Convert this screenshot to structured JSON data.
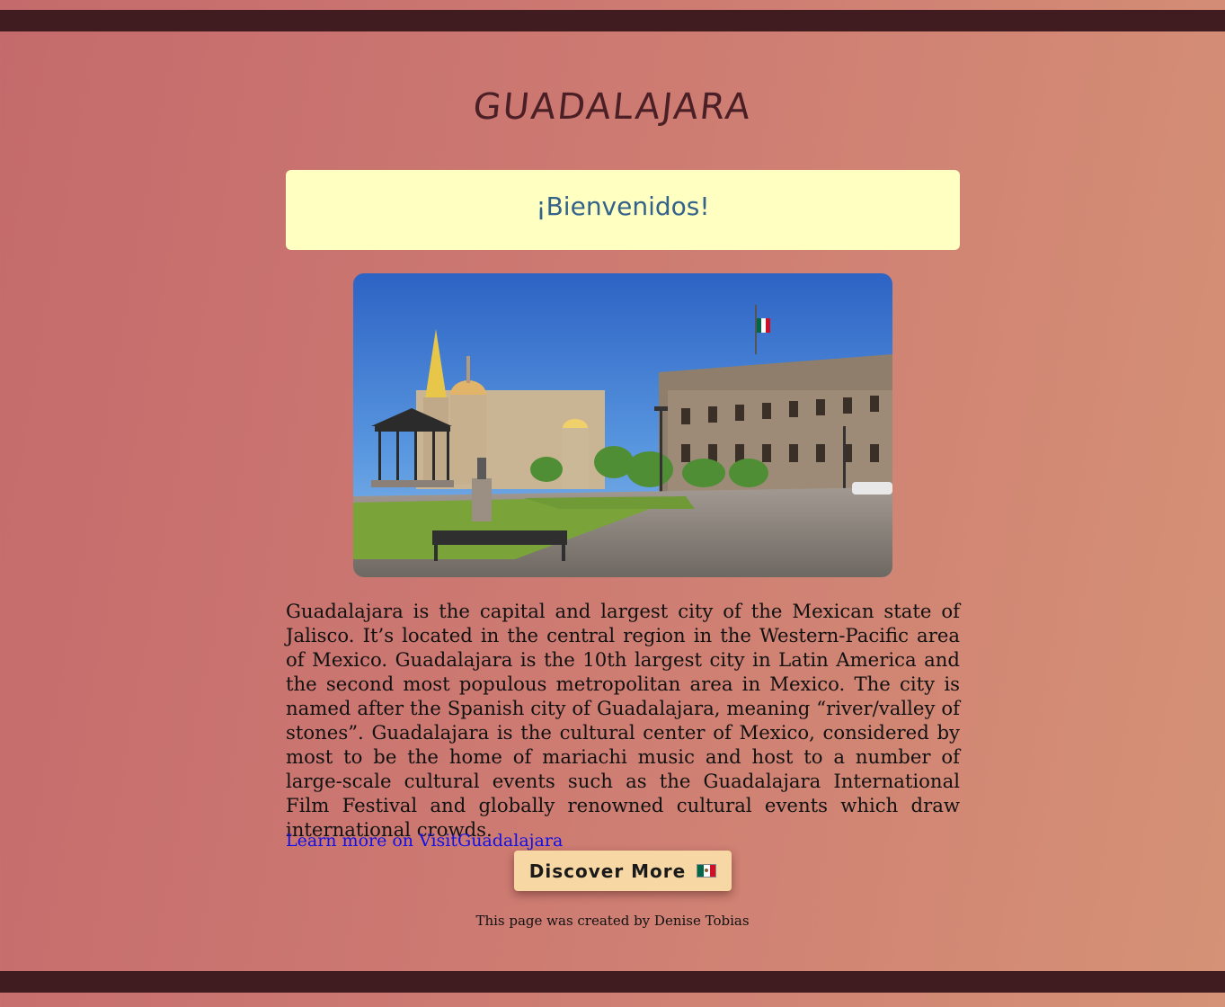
{
  "header": {
    "title": "GUADALAJARA"
  },
  "welcome": {
    "text": "¡Bienvenidos!"
  },
  "hero_image": {
    "icon": "plaza-photo"
  },
  "main": {
    "description": "Guadalajara is the capital and largest city of the Mexican state of Jalisco. It’s located in the central region in the Western-Pacific area of Mexico. Guadalajara is the 10th largest city in Latin America and the second most populous metropolitan area in Mexico. The city is named after the Spanish city of Guadalajara, meaning “river/valley of stones”. Guadalajara is the cultural center of Mexico, considered by most to be the home of mariachi music and host to a number of large-scale cultural events such as the Guadalajara International Film Festival and globally renowned cultural events which draw international crowds.",
    "link_text": "Learn more on VisitGuadalajara",
    "button_label": "Discover More"
  },
  "footer": {
    "credit": "This page was created by Denise Tobias"
  },
  "colors": {
    "bar": "#401c21",
    "title": "#4a1f25",
    "welcome_bg": "#ffffc2",
    "welcome_text": "#34638a",
    "link": "#1010e8",
    "button_bg": "#f7d7a4"
  }
}
